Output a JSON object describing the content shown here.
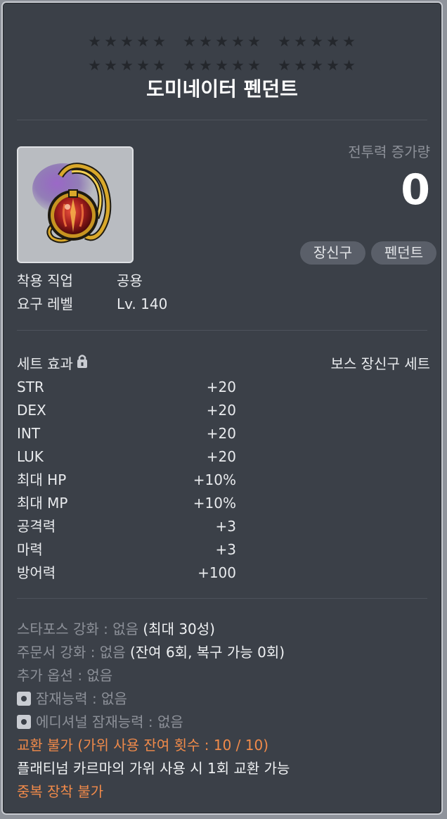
{
  "header": {
    "star_groups_row1": [
      5,
      5,
      5
    ],
    "star_groups_row2": [
      5,
      5,
      5
    ],
    "star_glyph": "★",
    "title": "도미네이터 펜던트"
  },
  "item": {
    "icon": "pendant-icon",
    "combat_power_label": "전투력 증가량",
    "combat_power_value": "0",
    "tags": [
      "장신구",
      "펜던트"
    ]
  },
  "requirements": [
    {
      "label": "착용 직업",
      "value": "공용"
    },
    {
      "label": "요구 레벨",
      "value": "Lv. 140"
    }
  ],
  "set_effect": {
    "label": "세트 효과",
    "lock_icon": "lock-icon",
    "set_name": "보스 장신구 세트",
    "stats": [
      {
        "name": "STR",
        "value": "+20"
      },
      {
        "name": "DEX",
        "value": "+20"
      },
      {
        "name": "INT",
        "value": "+20"
      },
      {
        "name": "LUK",
        "value": "+20"
      },
      {
        "name": "최대 HP",
        "value": "+10%"
      },
      {
        "name": "최대 MP",
        "value": "+10%"
      },
      {
        "name": "공격력",
        "value": "+3"
      },
      {
        "name": "마력",
        "value": "+3"
      },
      {
        "name": "방어력",
        "value": "+100"
      }
    ]
  },
  "enhancements": {
    "starforce_label": "스타포스 강화 : 없음",
    "starforce_note": "(최대 30성)",
    "scroll_label": "주문서 강화 : 없음",
    "scroll_note": "(잔여 6회, 복구 가능 0회)",
    "additional_option": "추가 옵션 : 없음",
    "potential": "잠재능력 : 없음",
    "additional_potential": "에디셔널 잠재능력 : 없음"
  },
  "trade": {
    "not_tradable": "교환 불가 (가위 사용 잔여 횟수 : 10 / 10)",
    "karma_note": "플래티넘 카르마의 가위 사용 시 1회 교환 가능",
    "no_duplicate": "중복 장착 불가"
  },
  "colors": {
    "panel_bg": "#3b4048",
    "accent_orange": "#f08a4a",
    "muted_grey": "#8d9199"
  }
}
